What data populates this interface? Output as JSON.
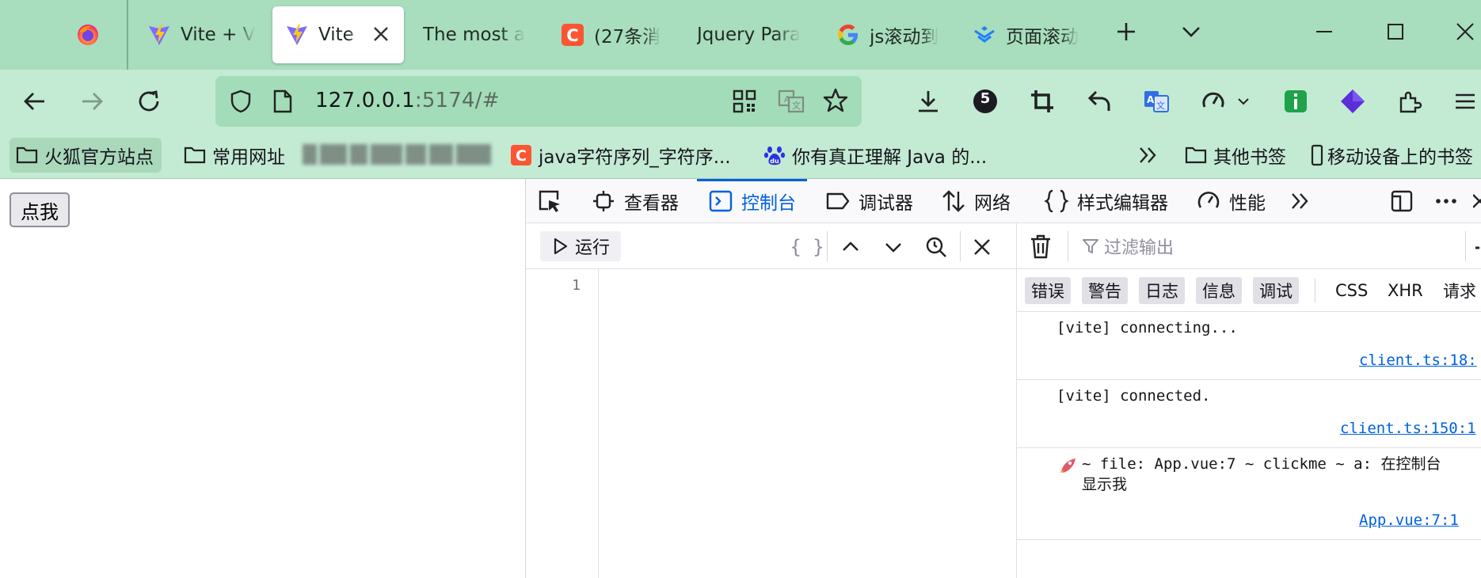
{
  "browser": {
    "tabs": [
      {
        "title": "",
        "icon": "firefox-icon"
      },
      {
        "title": "Vite + V",
        "icon": "vite-icon"
      },
      {
        "title": "Vite -",
        "icon": "vite-icon",
        "active": true
      },
      {
        "title": "The most a",
        "icon": ""
      },
      {
        "title": "(27条消",
        "icon": "csdn-icon"
      },
      {
        "title": "Jquery Para",
        "icon": ""
      },
      {
        "title": "js滚动到",
        "icon": "google-icon"
      },
      {
        "title": "页面滚动",
        "icon": "bookmark-app-icon"
      }
    ],
    "url_host": "127.0.0.1",
    "url_rest": ":5174/#",
    "extension_badge": "5"
  },
  "bookmarks": {
    "items": [
      {
        "label": "火狐官方站点"
      },
      {
        "label": "常用网址"
      },
      {
        "label": "java字符序列_字符序..."
      },
      {
        "label": "你有真正理解 Java 的..."
      }
    ],
    "other": "其他书签",
    "mobile": "移动设备上的书签"
  },
  "page": {
    "button_label": "点我"
  },
  "devtools": {
    "tabs": [
      {
        "label": "查看器"
      },
      {
        "label": "控制台",
        "active": true
      },
      {
        "label": "调试器"
      },
      {
        "label": "网络"
      },
      {
        "label": "样式编辑器"
      },
      {
        "label": "性能"
      }
    ],
    "editor": {
      "run_label": "运行",
      "pretty_label": "{ }",
      "line_number": "1"
    },
    "output": {
      "filter_placeholder": "过滤输出",
      "levels": [
        "错误",
        "警告",
        "日志",
        "信息",
        "调试"
      ],
      "extra_filters": [
        "CSS",
        "XHR",
        "请求"
      ],
      "messages": [
        {
          "text": "[vite] connecting...",
          "location": "client.ts:18:"
        },
        {
          "text": "[vite] connected.",
          "location": "client.ts:150:1"
        },
        {
          "text": "~ file: App.vue:7 ~ clickme ~ a: 在控制台\n显示我",
          "location": "App.vue:7:1",
          "icon": "rocket-icon"
        }
      ]
    }
  },
  "colors": {
    "tabbar": "#a8ddbd",
    "toolbar": "#c3ead3",
    "urlbar": "#a3dcb8",
    "accent": "#0060df"
  }
}
